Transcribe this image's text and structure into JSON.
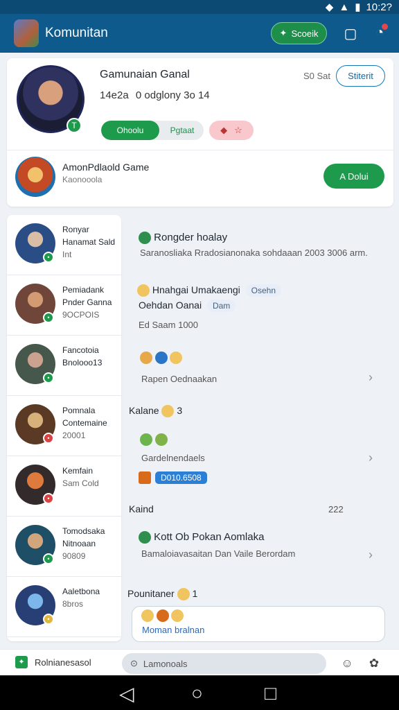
{
  "status_bar": {
    "time": "10:2?"
  },
  "app": {
    "title": "Komunitan",
    "action_pill": "Scoeik"
  },
  "profile": {
    "name": "Gamunaian Ganal",
    "stats": [
      "14e2a",
      "0 odglony 3o 14"
    ],
    "count": "S0 Sat",
    "outline_button": "Stiterit",
    "segment_left": "Ohoolu",
    "segment_right": "Pgtaat",
    "game": {
      "title": "AmonPdlaold Game",
      "subtitle": "Kaonooola",
      "button": "A Dolui"
    }
  },
  "left_rows": [
    {
      "name": "Ronyar Hanamat Sald",
      "sub": "Int"
    },
    {
      "name": "Pemiadank Pnder Ganna",
      "sub": "9OCPOIS"
    },
    {
      "name": "Fancotoia Bnolooo13",
      "sub": ""
    },
    {
      "name": "Pomnala Contemaine",
      "sub": "20001"
    },
    {
      "name": "Kemfain",
      "sub": "Sam Cold"
    },
    {
      "name": "Tomodsaka Nitnoaan",
      "sub": "90809"
    },
    {
      "name": "Aaletbona",
      "sub": "8bros"
    }
  ],
  "feed": {
    "post1": {
      "title": "Rongder hoalay",
      "body": "Saranosliaka Rradosianonaka sohdaaan 2003 3006 arm."
    },
    "post2": {
      "title": "Hnahgai Umakaengi",
      "tag1": "Osehn",
      "line2": "Oehdan Oanai",
      "tag2": "Dam",
      "meta": "Ed Saam 1000"
    },
    "post3": {
      "label": "Rapen Oednaakan"
    },
    "post4": {
      "title": "Kalane",
      "count": "3",
      "body": "Gardelnendaels",
      "code": "D010.6508"
    },
    "post5": {
      "title": "Kaind",
      "count": "222",
      "heading": "Kott Ob Pokan Aomlaka",
      "body": "Bamaloiavasaitan Dan Vaile Berordam"
    },
    "post6": {
      "title": "Pounitaner",
      "count": "1",
      "body": "Moman bralnan"
    }
  },
  "bottom_bar": {
    "left_label": "Rolnianesasol",
    "search": "Lamonoals"
  },
  "colors": {
    "primary_blue": "#0f5a8c",
    "green": "#1d9a4b",
    "accent_red": "#e6454c"
  },
  "icons": [
    "signal-icon",
    "battery-icon",
    "shield-icon",
    "bell-icon",
    "chevron-right-icon",
    "back-icon",
    "home-icon",
    "recents-icon"
  ]
}
